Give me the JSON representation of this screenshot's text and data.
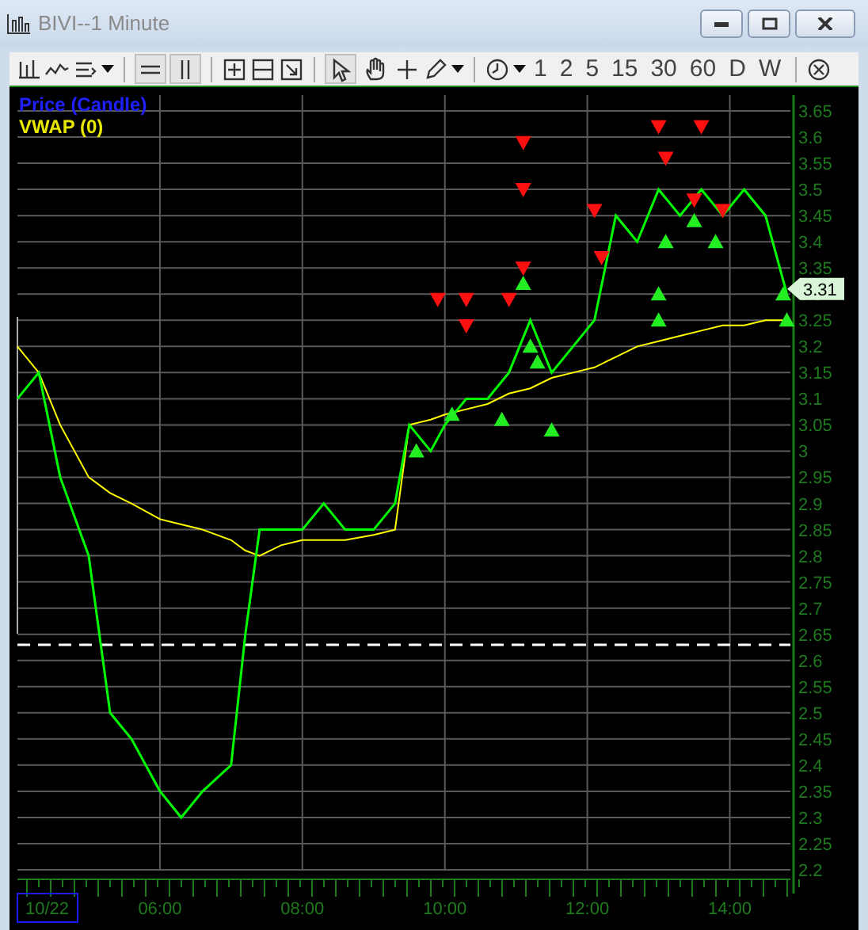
{
  "window": {
    "title": "BIVI--1 Minute"
  },
  "toolbar": {
    "intervals": [
      {
        "label": "1"
      },
      {
        "label": "2"
      },
      {
        "label": "5"
      },
      {
        "label": "15"
      },
      {
        "label": "30"
      },
      {
        "label": "60"
      },
      {
        "label": "D"
      },
      {
        "label": "W"
      }
    ],
    "toggles": [
      {
        "kind": "hlines",
        "selected": true
      },
      {
        "kind": "vlines",
        "selected": true
      },
      {
        "kind": "pointer",
        "selected": true
      },
      {
        "kind": "hand",
        "selected": false
      }
    ]
  },
  "chart": {
    "date_label": "10/22",
    "chart_data": {
      "type": "line",
      "x": [
        4.0,
        4.3,
        4.6,
        5.0,
        5.3,
        5.6,
        6.0,
        6.3,
        6.6,
        7.0,
        7.2,
        7.4,
        7.7,
        8.0,
        8.3,
        8.6,
        9.0,
        9.3,
        9.5,
        9.8,
        10.0,
        10.3,
        10.6,
        10.9,
        11.2,
        11.5,
        11.8,
        12.1,
        12.4,
        12.7,
        13.0,
        13.3,
        13.6,
        13.9,
        14.2,
        14.5,
        14.8
      ],
      "series": [
        {
          "name": "Price (Candle)",
          "color": "#00ff00",
          "values": [
            3.1,
            3.15,
            2.95,
            2.8,
            2.5,
            2.45,
            2.35,
            2.3,
            2.35,
            2.4,
            2.65,
            2.85,
            2.85,
            2.85,
            2.9,
            2.85,
            2.85,
            2.9,
            3.05,
            3.0,
            3.05,
            3.1,
            3.1,
            3.15,
            3.25,
            3.15,
            3.2,
            3.25,
            3.45,
            3.4,
            3.5,
            3.45,
            3.5,
            3.45,
            3.5,
            3.45,
            3.3
          ]
        },
        {
          "name": "VWAP (0)",
          "color": "#ffff00",
          "values": [
            3.2,
            3.15,
            3.05,
            2.95,
            2.92,
            2.9,
            2.87,
            2.86,
            2.85,
            2.83,
            2.81,
            2.8,
            2.82,
            2.83,
            2.83,
            2.83,
            2.84,
            2.85,
            3.05,
            3.06,
            3.07,
            3.08,
            3.09,
            3.11,
            3.12,
            3.14,
            3.15,
            3.16,
            3.18,
            3.2,
            3.21,
            3.22,
            3.23,
            3.24,
            3.24,
            3.25,
            3.25
          ]
        }
      ],
      "xlim": [
        4.0,
        14.85
      ],
      "ylim": [
        2.2,
        3.65
      ],
      "xticks": [
        {
          "value": 6,
          "label": "06:00"
        },
        {
          "value": 8,
          "label": "08:00"
        },
        {
          "value": 10,
          "label": "10:00"
        },
        {
          "value": 12,
          "label": "12:00"
        },
        {
          "value": 14,
          "label": "14:00"
        }
      ],
      "yticks": [
        2.2,
        2.25,
        2.3,
        2.35,
        2.4,
        2.45,
        2.5,
        2.55,
        2.6,
        2.65,
        2.7,
        2.75,
        2.8,
        2.85,
        2.9,
        2.95,
        3,
        3.05,
        3.1,
        3.15,
        3.2,
        3.25,
        3.3,
        3.35,
        3.4,
        3.45,
        3.5,
        3.55,
        3.6,
        3.65
      ],
      "grid": true,
      "ref_lines": [
        {
          "axis": "y",
          "value": 2.63
        }
      ],
      "annotations": [
        {
          "text": "3.31",
          "x": 14.85,
          "y": 3.31
        }
      ]
    }
  }
}
